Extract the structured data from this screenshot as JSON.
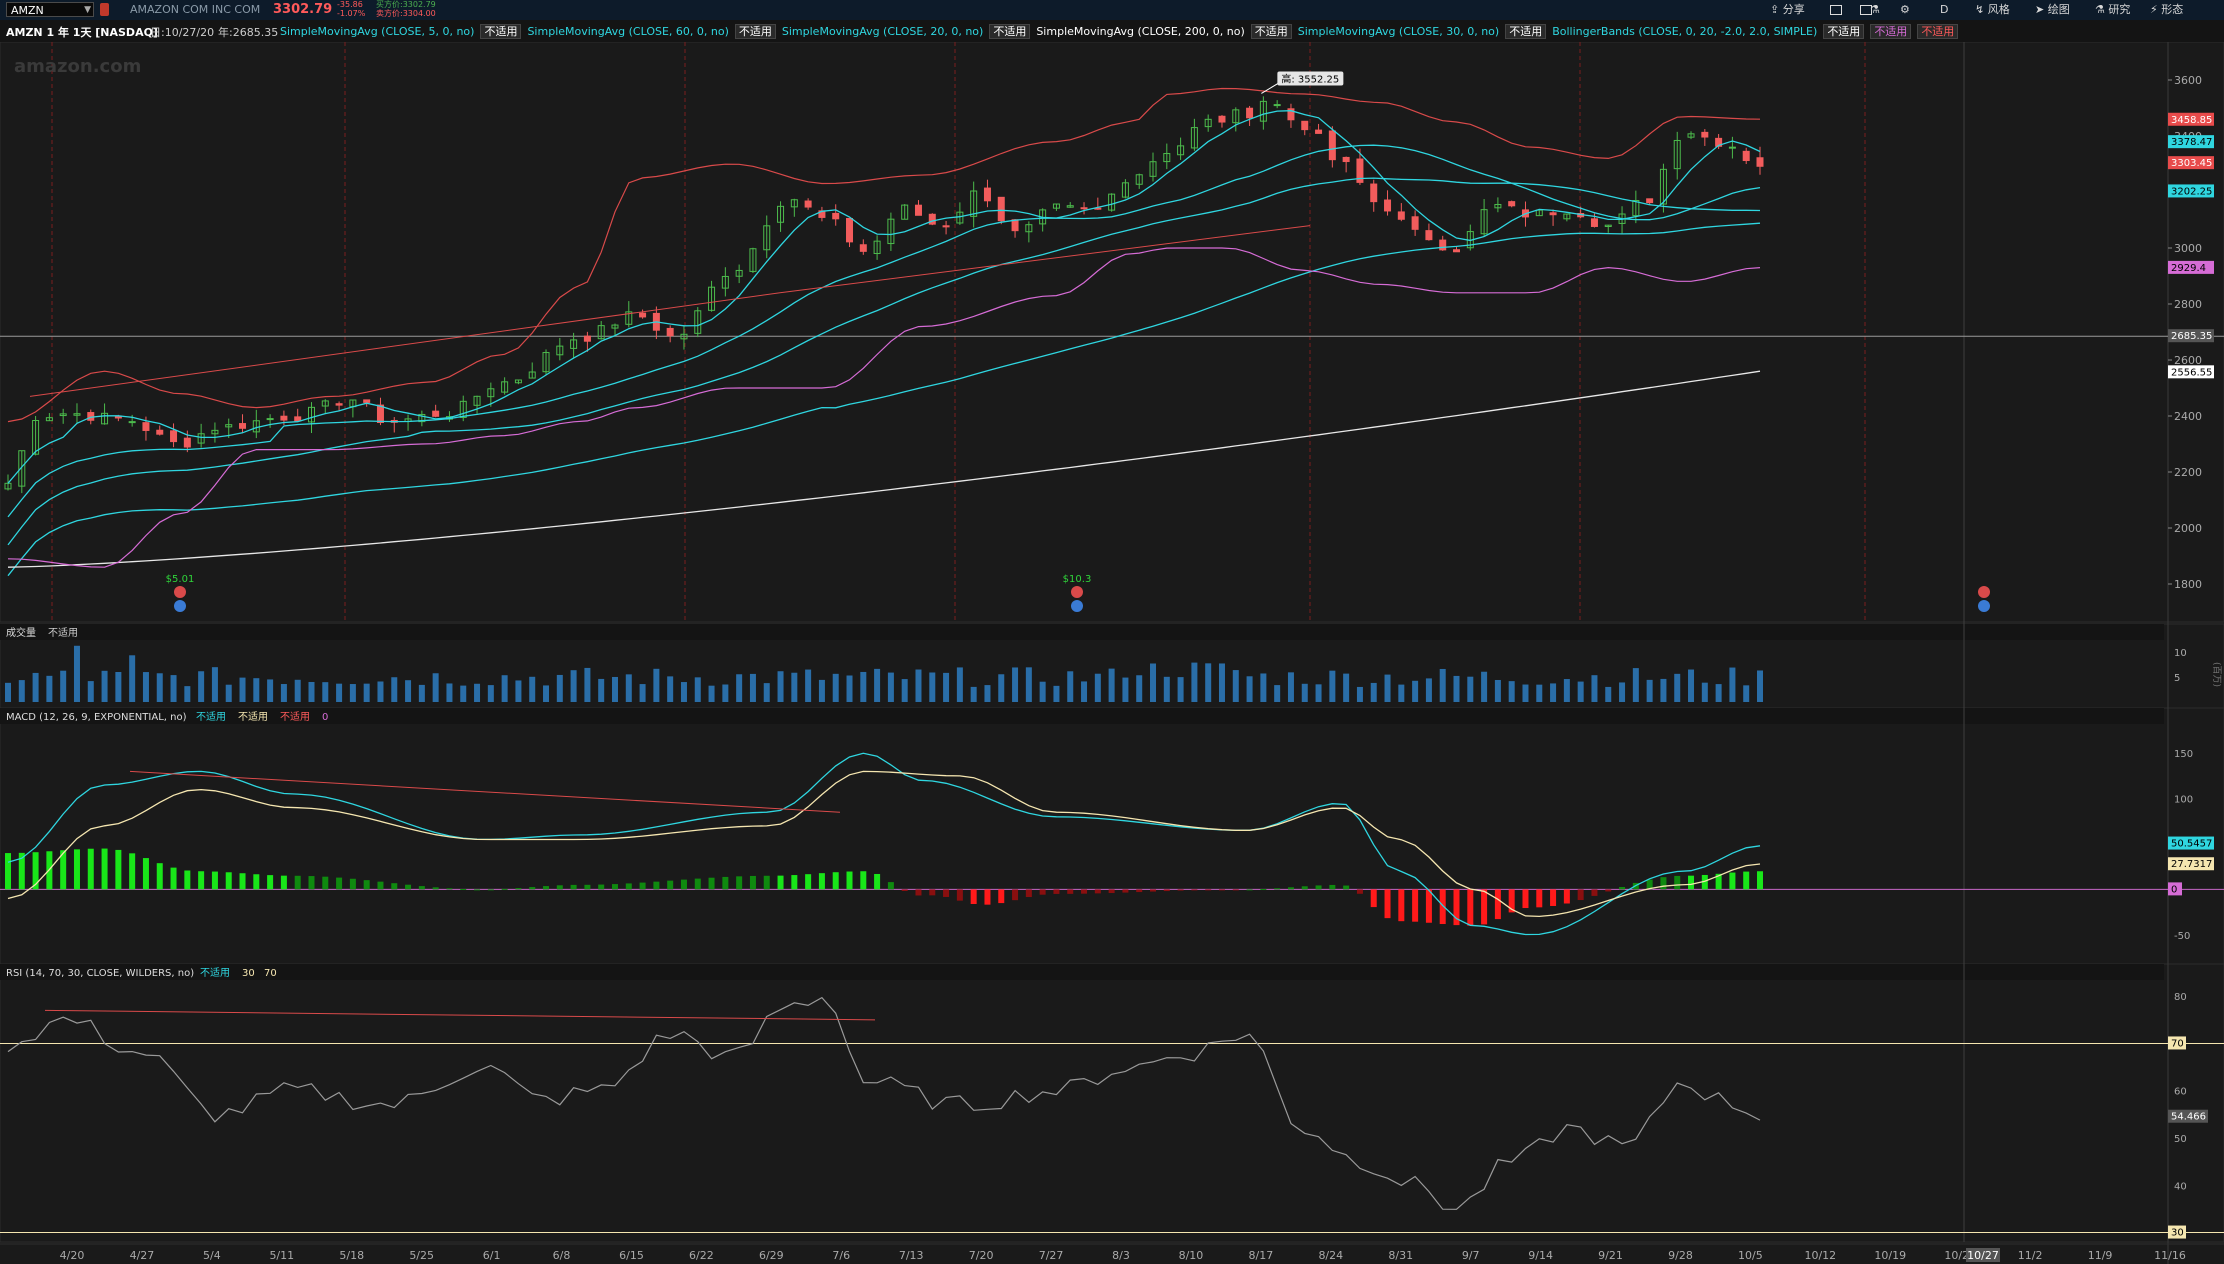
{
  "topbar": {
    "symbol": "AMZN",
    "company": "AMAZON COM INC COM",
    "last_price": "3302.79",
    "change_abs": "-35.86",
    "change_pct": "-1.07%",
    "bid": "买方价:3302.79",
    "ask": "卖方价:3304.00",
    "buttons": [
      "分享",
      "风格",
      "绘图",
      "研究",
      "形态"
    ],
    "period_label": "D"
  },
  "studies": {
    "title": "AMZN 1 年 1天 [NASDAQ]",
    "date_info": "日:10/27/20",
    "year_info": "年:2685.35",
    "items": [
      {
        "label": "SimpleMovingAvg (CLOSE, 5, 0, no)",
        "value": "不适用",
        "color": "#2fd6e0"
      },
      {
        "label": "SimpleMovingAvg (CLOSE, 60, 0, no)",
        "value": "不适用",
        "color": "#2fd6e0"
      },
      {
        "label": "SimpleMovingAvg (CLOSE, 20, 0, no)",
        "value": "不适用",
        "color": "#2fd6e0"
      },
      {
        "label": "SimpleMovingAvg (CLOSE, 200, 0, no)",
        "value": "不适用",
        "color": "#ffffff"
      },
      {
        "label": "SimpleMovingAvg (CLOSE, 30, 0, no)",
        "value": "不适用",
        "color": "#2fd6e0"
      },
      {
        "label": "BollingerBands (CLOSE, 0, 20, -2.0, 2.0, SIMPLE)",
        "value": "不适用",
        "color": "#2fd6e0"
      }
    ],
    "extra_values": [
      "不适用",
      "不适用"
    ]
  },
  "watermark": "amazon.com",
  "high_marker": "高: 3552.25",
  "dividend_labels": [
    "$5.01",
    "$10.3"
  ],
  "volume_panel": {
    "label": "成交量",
    "value": "不适用",
    "axis": [
      "10",
      "5"
    ],
    "unit": "(百万)"
  },
  "macd_panel": {
    "label": "MACD (12, 26, 9, EXPONENTIAL, no)",
    "values": [
      "不适用",
      "不适用",
      "不适用",
      "0"
    ]
  },
  "rsi_panel": {
    "label": "RSI (14, 70, 30, CLOSE, WILDERS, no)",
    "values": [
      "不适用",
      "30",
      "70"
    ]
  },
  "x_labels": [
    "4/20",
    "4/27",
    "5/4",
    "5/11",
    "5/18",
    "5/25",
    "6/1",
    "6/8",
    "6/15",
    "6/22",
    "6/29",
    "7/6",
    "7/13",
    "7/20",
    "7/27",
    "8/3",
    "8/10",
    "8/17",
    "8/24",
    "8/31",
    "9/7",
    "9/14",
    "9/21",
    "9/28",
    "10/5",
    "10/12",
    "10/19",
    "10/26",
    "11/2",
    "11/9",
    "11/16"
  ],
  "x_current": "10/27",
  "price_axis": [
    "3600",
    "3400",
    "3200",
    "3000",
    "2800",
    "2600",
    "2400",
    "2200",
    "2000",
    "1800"
  ],
  "price_tags": [
    {
      "text": "3458.85",
      "bg": "#e84b4b",
      "fg": "#ffffff"
    },
    {
      "text": "3378.47",
      "bg": "#2fd6e0",
      "fg": "#000000"
    },
    {
      "text": "3303.45",
      "bg": "#e84b4b",
      "fg": "#ffffff"
    },
    {
      "text": "3202.25",
      "bg": "#2fd6e0",
      "fg": "#000000"
    },
    {
      "text": "2929.4",
      "bg": "#d66cd6",
      "fg": "#000000"
    },
    {
      "text": "2685.35",
      "bg": "#555555",
      "fg": "#ffffff"
    },
    {
      "text": "2556.55",
      "bg": "#ffffff",
      "fg": "#000000"
    }
  ],
  "macd_axis": [
    "150",
    "100",
    "50",
    "0",
    "-50"
  ],
  "macd_tags": [
    {
      "text": "50.5457",
      "bg": "#2fd6e0",
      "fg": "#000000"
    },
    {
      "text": "27.7317",
      "bg": "#f5e6b0",
      "fg": "#000000"
    },
    {
      "text": "0",
      "bg": "#d66cd6",
      "fg": "#000000"
    }
  ],
  "rsi_axis": [
    "80",
    "70",
    "60",
    "50",
    "40",
    "30"
  ],
  "rsi_tags": [
    {
      "text": "54.466",
      "bg": "#555555",
      "fg": "#ffffff"
    },
    {
      "text": "70",
      "bg": "#f5e6b0",
      "fg": "#000000"
    },
    {
      "text": "30",
      "bg": "#f5e6b0",
      "fg": "#000000"
    }
  ],
  "chart_data": {
    "type": "line",
    "title": "AMZN 1 年 1天 [NASDAQ]",
    "ylim": [
      1700,
      3700
    ],
    "series": [
      {
        "name": "SimpleMovingAvg (CLOSE, 5, 0, no)",
        "x": [
          "4/17",
          "5/4",
          "5/18",
          "6/1",
          "6/15",
          "6/29",
          "7/13",
          "7/27",
          "8/10",
          "8/24",
          "8/31",
          "9/7",
          "9/21",
          "10/5",
          "10/12",
          "10/26"
        ],
        "values": [
          2350,
          2330,
          2380,
          2440,
          2570,
          2840,
          3100,
          3050,
          3160,
          3250,
          3380,
          3300,
          3000,
          3180,
          3380,
          3330
        ]
      },
      {
        "name": "SimpleMovingAvg (CLOSE, 200, 0, no)",
        "x": [
          "4/17",
          "5/18",
          "6/15",
          "7/13",
          "8/10",
          "9/7",
          "10/5",
          "10/26"
        ],
        "values": [
          1860,
          1900,
          1980,
          2080,
          2190,
          2310,
          2450,
          2560
        ]
      },
      {
        "name": "BollingerBands (CLOSE, 0, 20, -2.0, 2.0, SIMPLE)",
        "x": [
          "4/17",
          "5/4",
          "5/18",
          "6/1",
          "6/15",
          "7/13",
          "7/27",
          "8/24",
          "9/7",
          "9/21",
          "10/5",
          "10/26"
        ],
        "values": [
          2470,
          2600,
          2450,
          2470,
          2600,
          3250,
          3230,
          3380,
          3560,
          3510,
          3330,
          3460
        ]
      }
    ]
  }
}
